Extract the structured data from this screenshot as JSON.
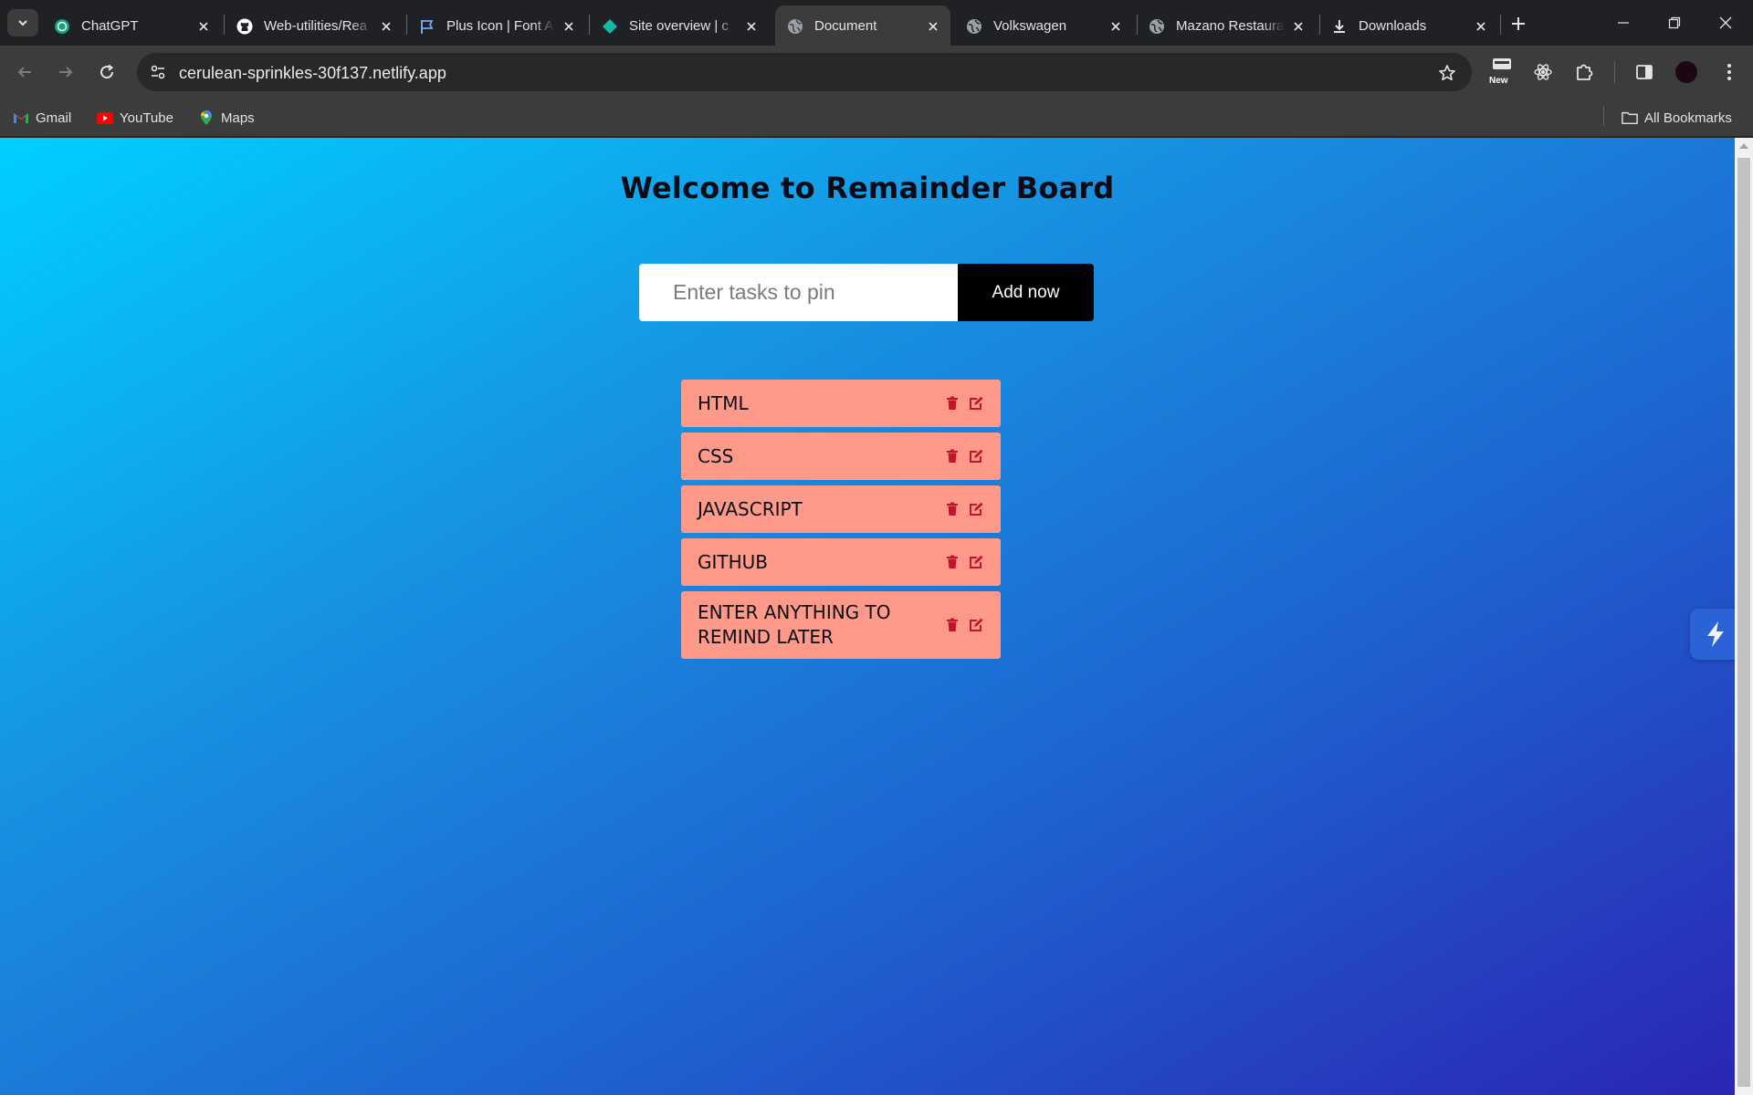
{
  "browser": {
    "tabs": [
      {
        "title": "ChatGPT",
        "icon": "chatgpt-icon",
        "active": false
      },
      {
        "title": "Web-utilities/Rea",
        "icon": "github-icon",
        "active": false
      },
      {
        "title": "Plus Icon | Font A",
        "icon": "flag-icon",
        "active": false
      },
      {
        "title": "Site overview | c",
        "icon": "netlify-icon",
        "active": false
      },
      {
        "title": "Document",
        "icon": "globe-icon",
        "active": true
      },
      {
        "title": "Volkswagen",
        "icon": "globe-icon",
        "active": false
      },
      {
        "title": "Mazano Restaura",
        "icon": "globe-icon",
        "active": false
      },
      {
        "title": "Downloads",
        "icon": "download-icon",
        "active": false
      }
    ],
    "url": "cerulean-sprinkles-30f137.netlify.app",
    "toolbar": {
      "new_badge": "New"
    },
    "bookmarks": [
      {
        "label": "Gmail",
        "icon": "gmail-icon"
      },
      {
        "label": "YouTube",
        "icon": "youtube-icon"
      },
      {
        "label": "Maps",
        "icon": "maps-icon"
      }
    ],
    "all_bookmarks": "All Bookmarks"
  },
  "page": {
    "title": "Welcome to Remainder Board",
    "input_placeholder": "Enter tasks to pin",
    "add_button": "Add now",
    "tasks": [
      {
        "text": "HTML"
      },
      {
        "text": "CSS"
      },
      {
        "text": "JAVASCRIPT"
      },
      {
        "text": "GITHUB"
      },
      {
        "text": "ENTER ANYTHING TO REMIND LATER"
      }
    ]
  },
  "colors": {
    "task_bg": "#ff9a8b",
    "task_icon": "#c0152a",
    "gradient_start": "#00cfff",
    "gradient_end": "#2b24b5",
    "button_bg": "#000000"
  }
}
